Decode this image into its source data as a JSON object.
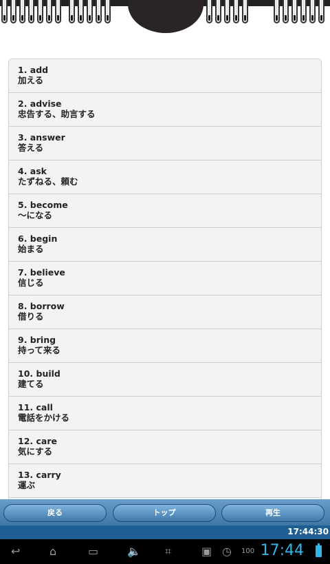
{
  "words": [
    {
      "en": "1. add",
      "ja": "加える"
    },
    {
      "en": "2. advise",
      "ja": "忠告する、助言する"
    },
    {
      "en": "3. answer",
      "ja": "答える"
    },
    {
      "en": "4. ask",
      "ja": "たずねる、頼む"
    },
    {
      "en": "5. become",
      "ja": "〜になる"
    },
    {
      "en": "6. begin",
      "ja": "始まる"
    },
    {
      "en": "7. believe",
      "ja": "信じる"
    },
    {
      "en": "8. borrow",
      "ja": "借りる"
    },
    {
      "en": "9. bring",
      "ja": "持って来る"
    },
    {
      "en": "10. build",
      "ja": "建てる"
    },
    {
      "en": "11. call",
      "ja": "電話をかける"
    },
    {
      "en": "12. care",
      "ja": "気にする"
    },
    {
      "en": "13. carry",
      "ja": "運ぶ"
    }
  ],
  "buttons": {
    "back": "戻る",
    "top": "トップ",
    "play": "再生"
  },
  "status_time": "17:44:30",
  "nav": {
    "clock": "17:44",
    "signal": "100"
  }
}
